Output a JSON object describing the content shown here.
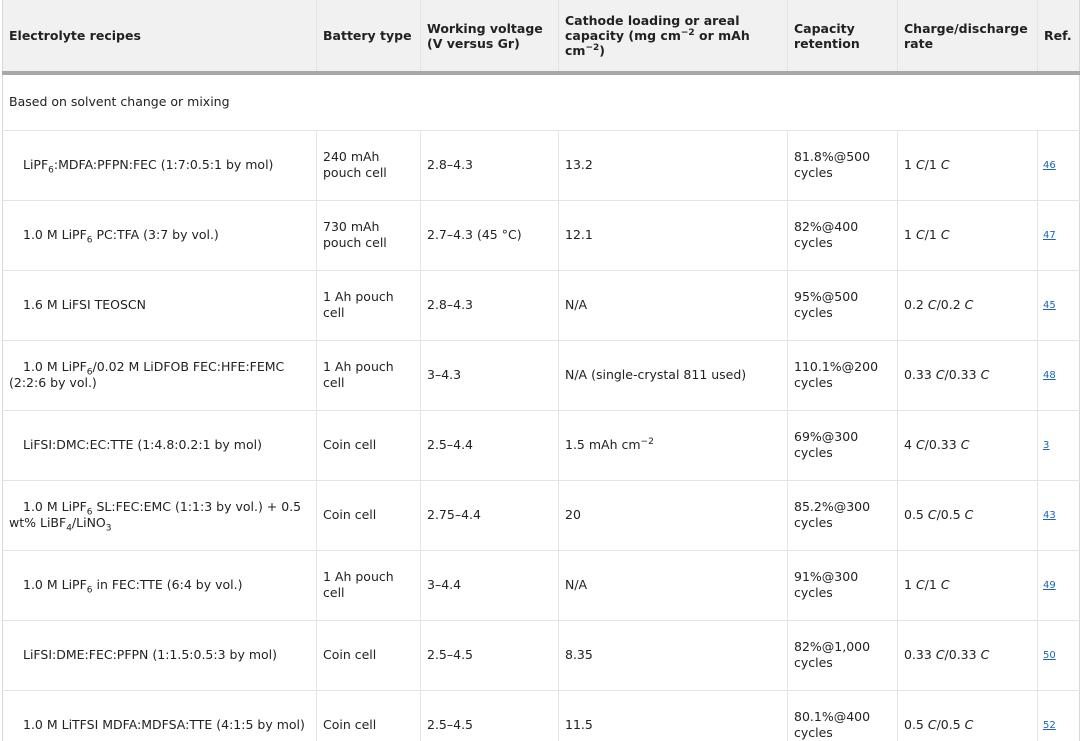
{
  "table": {
    "headers": [
      "Electrolyte recipes",
      "Battery type",
      "Working voltage (V versus Gr)",
      "Cathode loading or areal capacity (mg cm−2 or mAh cm−2)",
      "Capacity retention",
      "Charge/discharge rate",
      "Ref."
    ],
    "header_parts": {
      "h4_a": "Cathode loading or areal capacity (mg cm",
      "h4_sup1": "−2",
      "h4_b": " or mAh cm",
      "h4_sup2": "−2",
      "h4_c": ")"
    },
    "section_label": "Based on solvent change or mixing",
    "rows": [
      {
        "recipe": "LiPF6:MDFA:PFPN:FEC (1:7:0.5:1 by mol)",
        "recipe_parts": [
          "LiPF",
          "6",
          ":MDFA:PFPN:FEC (1:7:0.5:1 by mol)"
        ],
        "battery": "240 mAh pouch cell",
        "voltage": "2.8–4.3",
        "cathode": "13.2",
        "retention": "81.8%@500 cycles",
        "rate": "1 C/1 C",
        "ref": "46"
      },
      {
        "recipe": "1.0 M LiPF6 PC:TFA (3:7 by vol.)",
        "recipe_parts": [
          "1.0 M LiPF",
          "6",
          " PC:TFA (3:7 by vol.)"
        ],
        "battery": "730 mAh pouch cell",
        "voltage": "2.7–4.3 (45 °C)",
        "cathode": "12.1",
        "retention": "82%@400 cycles",
        "rate": "1 C/1 C",
        "ref": "47"
      },
      {
        "recipe": "1.6 M LiFSI TEOSCN",
        "battery": "1 Ah pouch cell",
        "voltage": "2.8–4.3",
        "cathode": "N/A",
        "retention": "95%@500 cycles",
        "rate": "0.2 C/0.2 C",
        "ref": "45"
      },
      {
        "recipe": "1.0 M LiPF6/0.02 M LiDFOB FEC:HFE:FEMC (2:2:6 by vol.)",
        "recipe_parts": [
          "1.0 M LiPF",
          "6",
          "/0.02 M LiDFOB FEC:HFE:FEMC (2:2:6 by vol.)"
        ],
        "battery": "1 Ah pouch cell",
        "voltage": "3–4.3",
        "cathode": "N/A (single-crystal 811 used)",
        "retention": "110.1%@200 cycles",
        "rate": "0.33 C/0.33 C",
        "ref": "48"
      },
      {
        "recipe": "LiFSI:DMC:EC:TTE (1:4.8:0.2:1 by mol)",
        "battery": "Coin cell",
        "voltage": "2.5–4.4",
        "cathode": "1.5 mAh cm−2",
        "cathode_parts": [
          "1.5 mAh cm",
          "−2"
        ],
        "retention": "69%@300 cycles",
        "rate": "4 C/0.33 C",
        "ref": "3"
      },
      {
        "recipe": "1.0 M LiPF6 SL:FEC:EMC (1:1:3 by vol.) + 0.5 wt% LiBF4/LiNO3",
        "recipe_parts": [
          "1.0 M LiPF",
          "6",
          " SL:FEC:EMC (1:1:3 by vol.) + 0.5 wt% LiBF",
          "4",
          "/LiNO",
          "3"
        ],
        "battery": "Coin cell",
        "voltage": "2.75–4.4",
        "cathode": "20",
        "retention": "85.2%@300 cycles",
        "rate": "0.5 C/0.5 C",
        "ref": "43"
      },
      {
        "recipe": "1.0 M LiPF6 in FEC:TTE (6:4 by vol.)",
        "recipe_parts": [
          "1.0 M LiPF",
          "6",
          " in FEC:TTE (6:4 by vol.)"
        ],
        "battery": "1 Ah pouch cell",
        "voltage": "3–4.4",
        "cathode": "N/A",
        "retention": "91%@300 cycles",
        "rate": "1 C/1 C",
        "ref": "49"
      },
      {
        "recipe": "LiFSI:DME:FEC:PFPN (1:1.5:0.5:3 by mol)",
        "battery": "Coin cell",
        "voltage": "2.5–4.5",
        "cathode": "8.35",
        "retention": "82%@1,000 cycles",
        "rate": "0.33 C/0.33 C",
        "ref": "50"
      },
      {
        "recipe": "1.0 M LiTFSI MDFA:MDFSA:TTE (4:1:5 by mol)",
        "battery": "Coin cell",
        "voltage": "2.5–4.5",
        "cathode": "11.5",
        "retention": "80.1%@400 cycles",
        "rate": "0.5 C/0.5 C",
        "ref": "52"
      }
    ]
  },
  "colors": {
    "header_bg": "#f1f1f1",
    "header_rule": "#a8a8a8",
    "grid": "#e4e4e4",
    "link": "#1b65b0",
    "text": "#222222"
  }
}
